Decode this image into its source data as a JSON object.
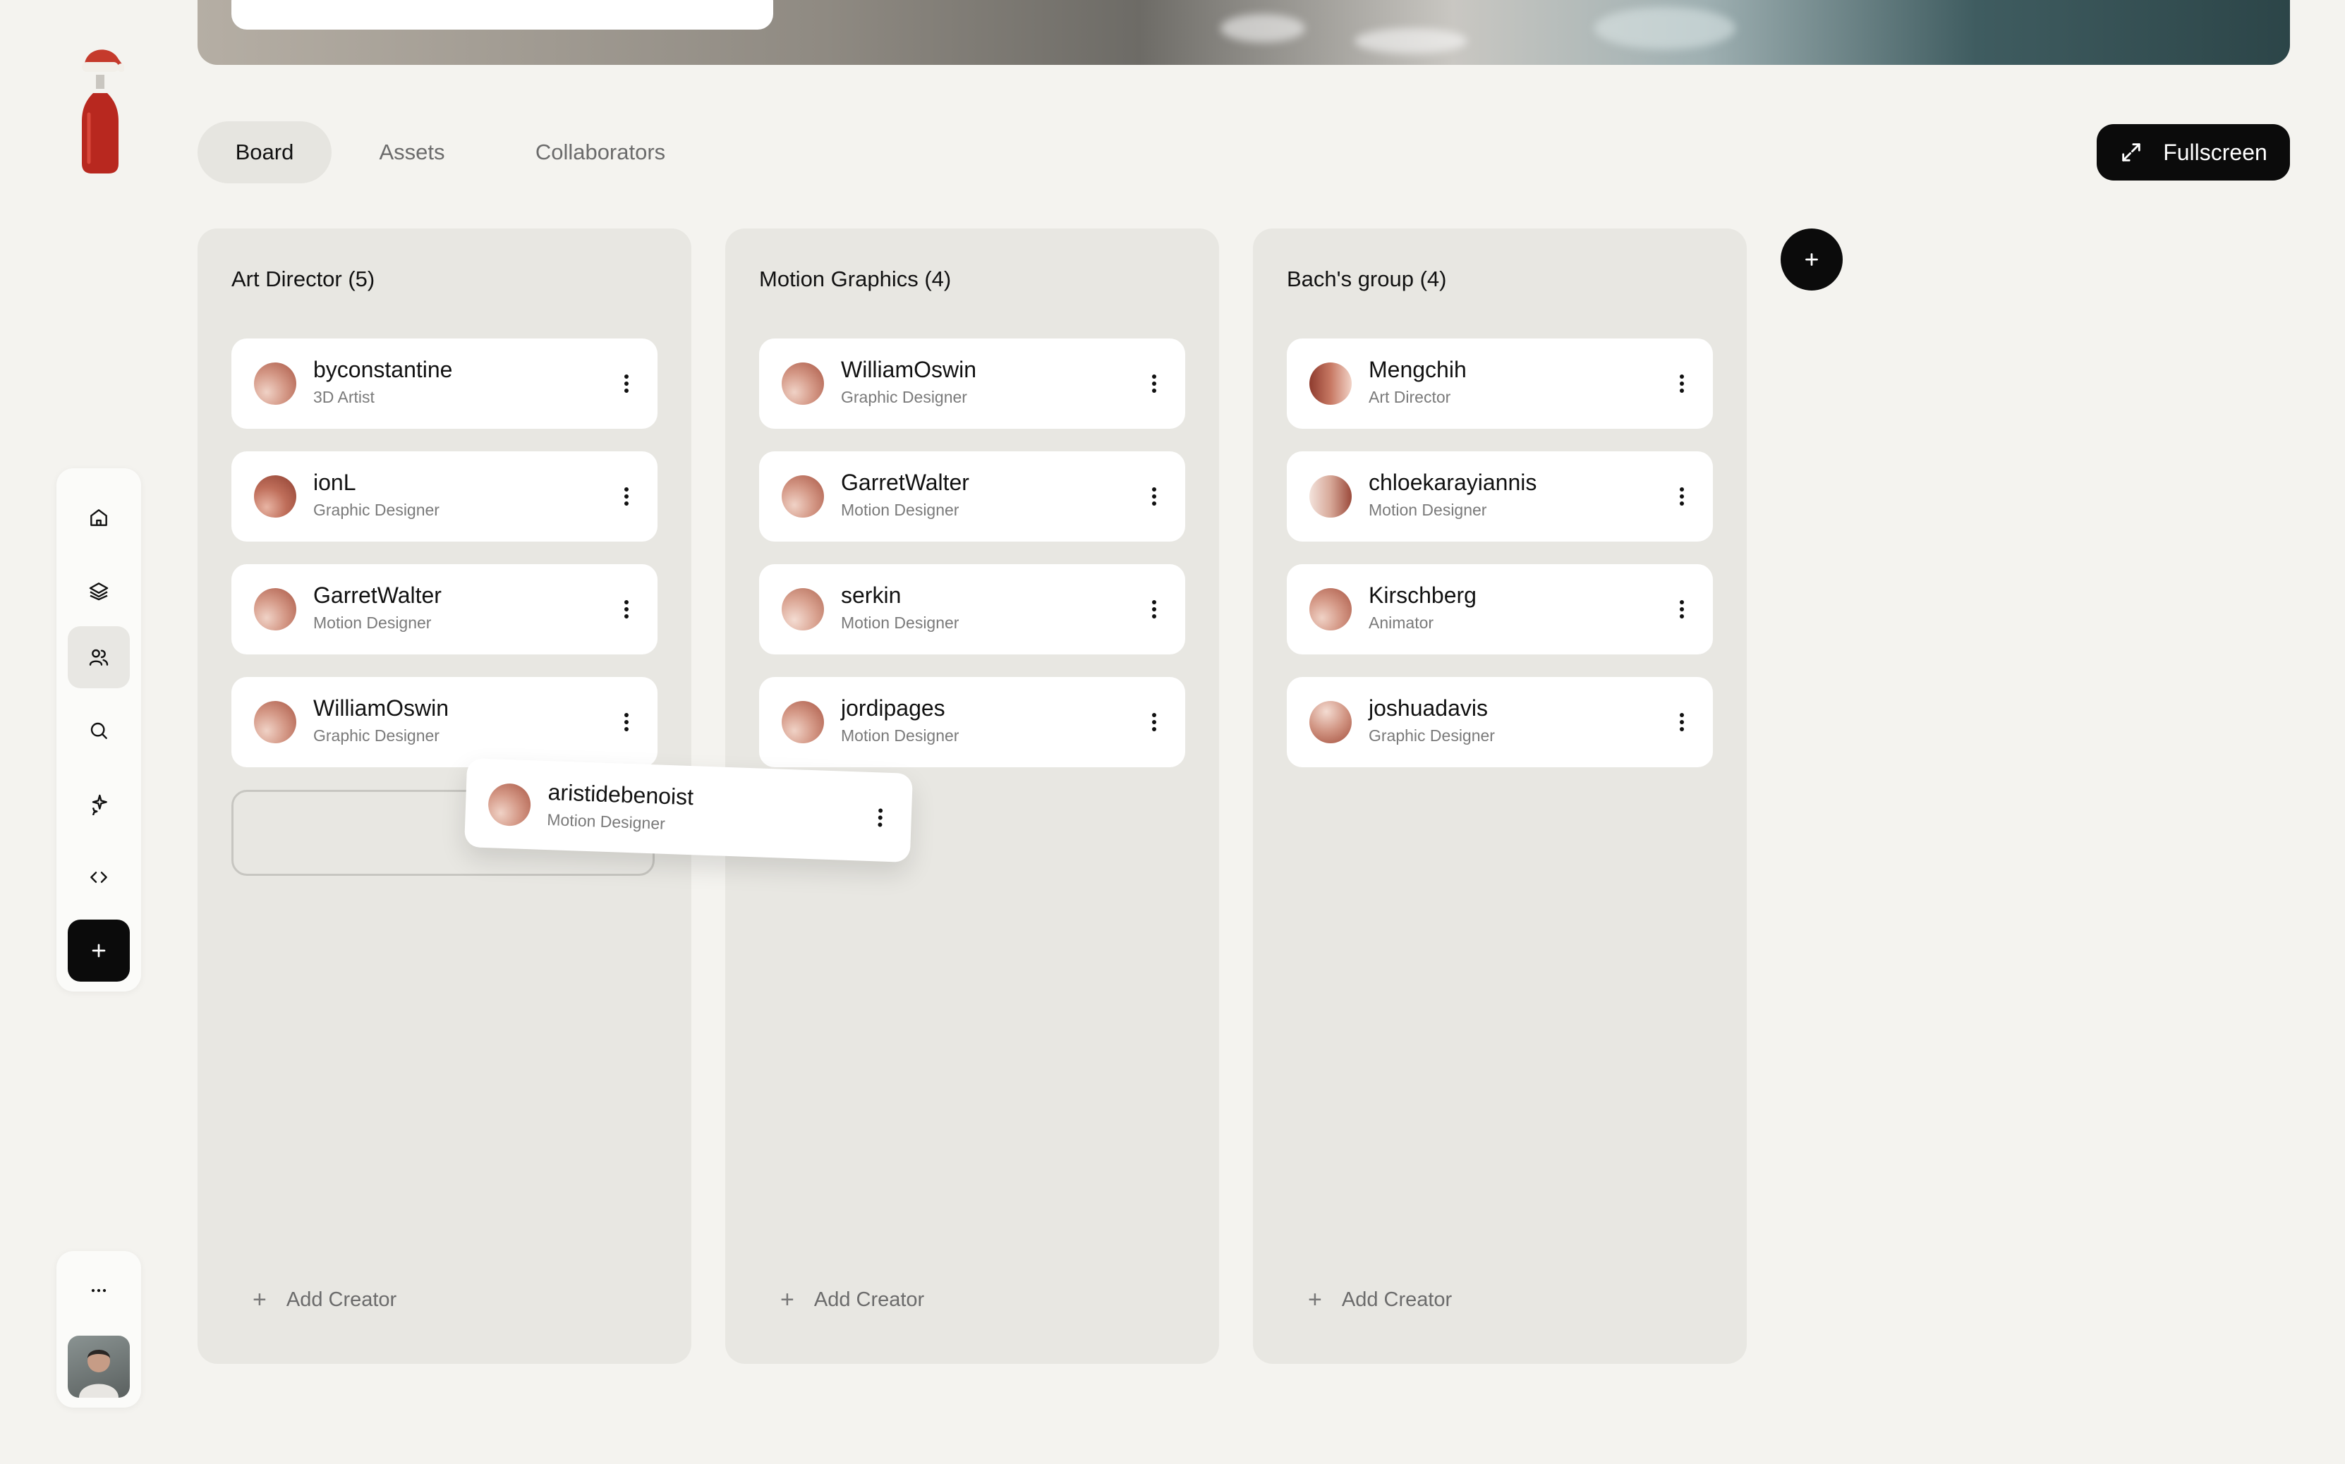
{
  "tabs": [
    {
      "label": "Board",
      "active": true
    },
    {
      "label": "Assets",
      "active": false
    },
    {
      "label": "Collaborators",
      "active": false
    }
  ],
  "fullscreen_label": "Fullscreen",
  "sidebar_icons": [
    "home-icon",
    "layers-icon",
    "users-icon",
    "search-icon",
    "sparkle-icon",
    "code-icon",
    "plus-icon"
  ],
  "columns": [
    {
      "title": "Art Director (5)",
      "cards": [
        {
          "name": "byconstantine",
          "role": "3D Artist"
        },
        {
          "name": "ionL",
          "role": "Graphic Designer"
        },
        {
          "name": "GarretWalter",
          "role": "Motion Designer"
        },
        {
          "name": "WilliamOswin",
          "role": "Graphic Designer"
        }
      ],
      "add_label": "Add Creator"
    },
    {
      "title": "Motion Graphics (4)",
      "cards": [
        {
          "name": "WilliamOswin",
          "role": "Graphic Designer"
        },
        {
          "name": "GarretWalter",
          "role": "Motion Designer"
        },
        {
          "name": "serkin",
          "role": "Motion Designer"
        },
        {
          "name": "jordipages",
          "role": "Motion Designer"
        }
      ],
      "add_label": "Add Creator"
    },
    {
      "title": "Bach's group (4)",
      "cards": [
        {
          "name": "Mengchih",
          "role": "Art Director"
        },
        {
          "name": "chloekarayiannis",
          "role": "Motion Designer"
        },
        {
          "name": "Kirschberg",
          "role": "Animator"
        },
        {
          "name": "joshuadavis",
          "role": "Graphic Designer"
        }
      ],
      "add_label": "Add Creator"
    }
  ],
  "dragging_card": {
    "name": "aristidebenoist",
    "role": "Motion Designer"
  },
  "colors": {
    "accent": "#0b0b0b",
    "background": "#f4f3ef",
    "column": "#e8e7e2"
  }
}
